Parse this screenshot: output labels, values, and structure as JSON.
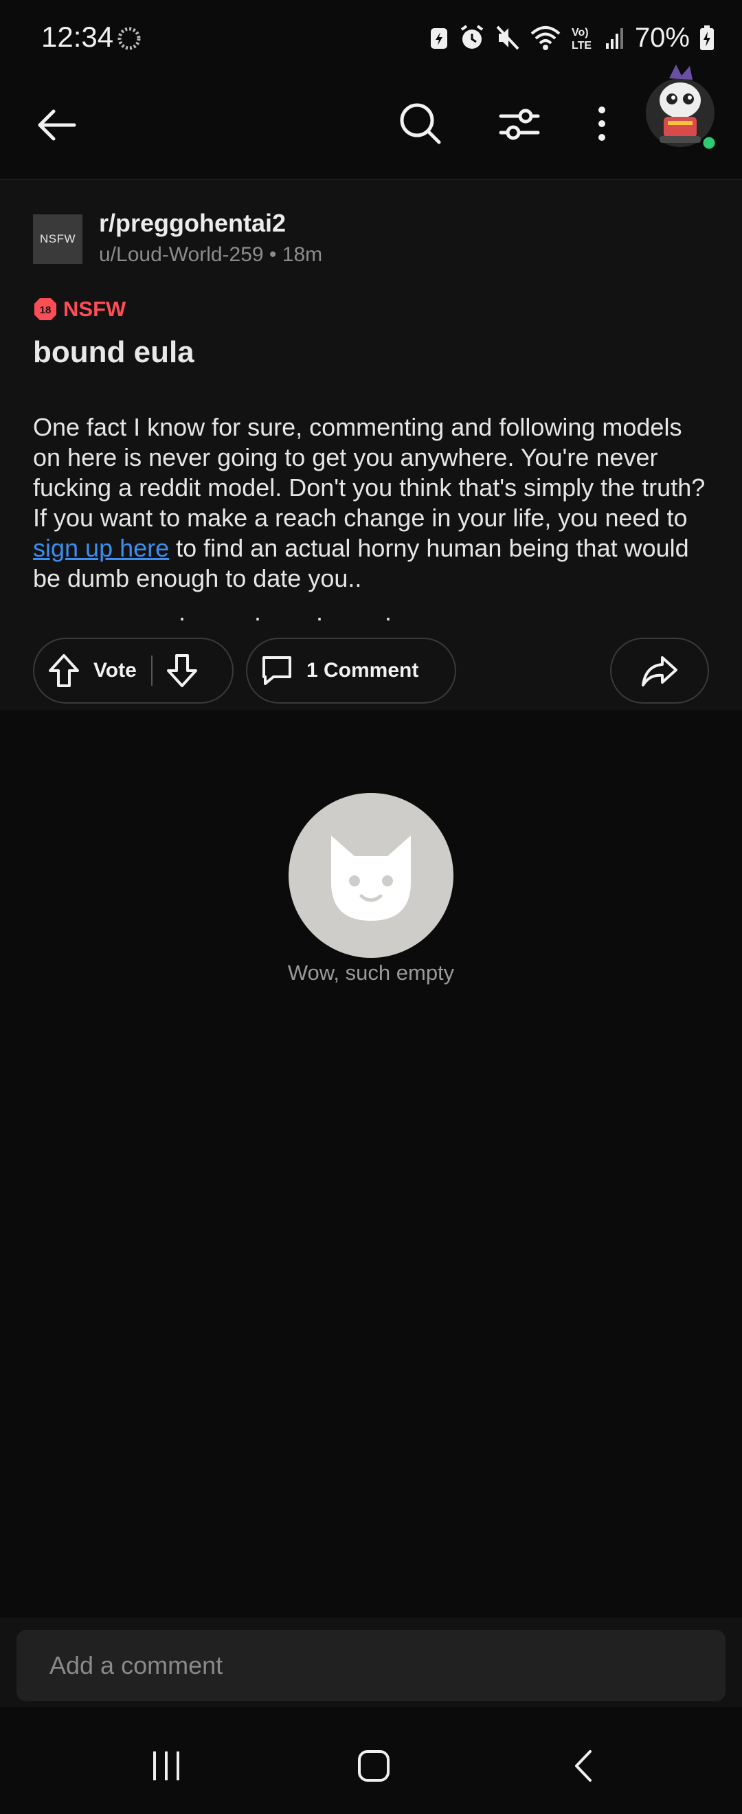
{
  "status_bar": {
    "time": "12:34",
    "battery_percent": "70%",
    "icons": [
      "loading-icon",
      "battery-saver-icon",
      "alarm-icon",
      "mute-icon",
      "wifi-icon",
      "volte-icon",
      "signal-icon",
      "battery-icon"
    ]
  },
  "top_bar": {
    "icons": [
      "back-arrow-icon",
      "search-icon",
      "filter-icon",
      "more-vert-icon",
      "avatar"
    ],
    "online_color": "#2ecc71"
  },
  "post": {
    "subreddit_avatar_text": "NSFW",
    "subreddit": "r/preggohentai2",
    "meta": "u/Loud-World-259 • 18m",
    "nsfw_badge_number": "18",
    "nsfw_label": "NSFW",
    "title": "bound eula",
    "body_before_link": "One fact I know for sure, commenting and following models on here is never going to get you anywhere. You're never fucking a reddit model. Don't you think that's simply the truth? If you want to make a reach change in your life, you need to ",
    "link_text": "sign up here",
    "body_after_link": " to find an actual horny human being that would be dumb enough to date you..",
    "trailing_dots": ".          .        .         .",
    "vote_label": "Vote",
    "comment_label": "1 Comment"
  },
  "empty_state": {
    "text": "Wow, such empty"
  },
  "comment_bar": {
    "placeholder": "Add a comment"
  },
  "nav_bar": {
    "icons": [
      "recent-apps-icon",
      "home-icon",
      "back-icon"
    ]
  },
  "colors": {
    "nsfw": "#ff4d57",
    "link": "#3b8ef0",
    "background": "#0b0b0b",
    "card": "#121212"
  }
}
